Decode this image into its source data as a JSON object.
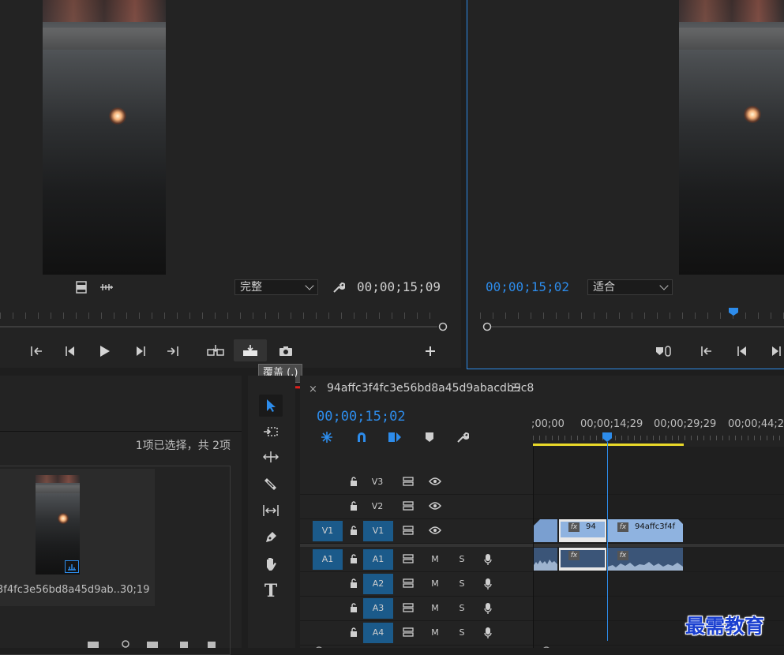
{
  "source_monitor": {
    "quality_dropdown": "完整",
    "timecode": "00;00;15;09",
    "tooltip": "覆盖 (.)"
  },
  "program_monitor": {
    "timecode": "00;00;15;02",
    "fit_dropdown": "适合"
  },
  "project_panel": {
    "selection_status": "1项已选择，共 2项",
    "item_name": "3f4fc3e56bd8a45d9ab...",
    "item_duration": "30;19"
  },
  "timeline": {
    "sequence_name": "94affc3f4fc3e56bd8a45d9abacdb9c8",
    "timecode": "00;00;15;02",
    "ruler_labels": [
      ";00;00",
      "00;00;14;29",
      "00;00;29;29",
      "00;00;44;28"
    ],
    "video_tracks": [
      {
        "name": "V3",
        "source": ""
      },
      {
        "name": "V2",
        "source": ""
      },
      {
        "name": "V1",
        "source": "V1"
      }
    ],
    "audio_tracks": [
      {
        "name": "A1",
        "source": "A1",
        "m": "M",
        "s": "S"
      },
      {
        "name": "A2",
        "source": "",
        "m": "M",
        "s": "S"
      },
      {
        "name": "A3",
        "source": "",
        "m": "M",
        "s": "S"
      },
      {
        "name": "A4",
        "source": "",
        "m": "M",
        "s": "S"
      }
    ],
    "clip_fx": "fx",
    "clip_a_label": "94",
    "clip_b_label": "94affc3f4f"
  },
  "watermark": "最需教育",
  "colors": {
    "accent": "#2d8ceb",
    "track_target": "#1b5a8a",
    "clip_video": "#8fb3e0",
    "clip_audio": "#3b5578",
    "work_area": "#e8d829",
    "underline": "#e0201c"
  }
}
